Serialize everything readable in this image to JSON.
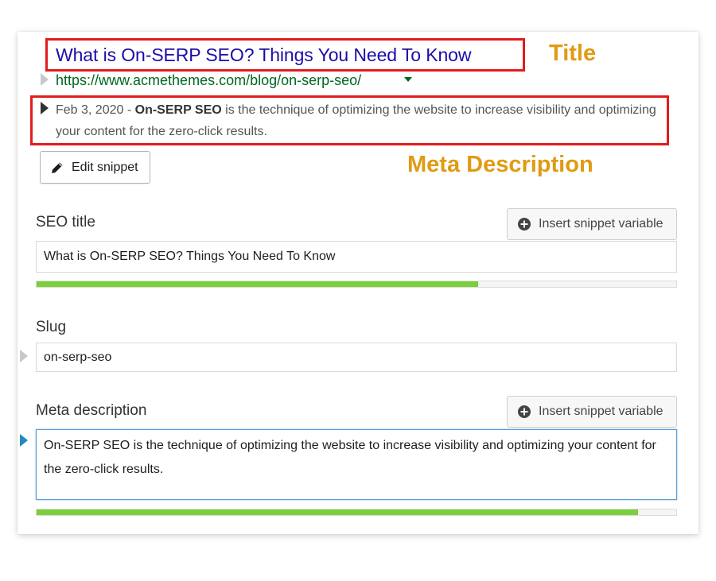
{
  "preview": {
    "title": "What is On-SERP SEO? Things You Need To Know",
    "url": "https://www.acmethemes.com/blog/on-serp-seo/",
    "date": "Feb 3, 2020",
    "separator": " - ",
    "keyword": "On-SERP SEO",
    "desc_rest": " is the technique of optimizing the website to increase visibility and optimizing your content for the zero-click results."
  },
  "annotations": {
    "title_label": "Title",
    "meta_label": "Meta Description",
    "color": "#e09b13",
    "box_color": "#e21c1c"
  },
  "buttons": {
    "edit_snippet": "Edit snippet",
    "insert_snippet_variable": "Insert snippet variable"
  },
  "fields": {
    "seo_title": {
      "label": "SEO title",
      "value": "What is On-SERP SEO? Things You Need To Know",
      "progress": 0.69
    },
    "slug": {
      "label": "Slug",
      "value": "on-serp-seo"
    },
    "meta_description": {
      "label": "Meta description",
      "value": "On-SERP SEO is the technique of optimizing the website to increase visibility and optimizing your content for the zero-click results.",
      "progress": 0.94
    }
  },
  "colors": {
    "title_link": "#1a0dab",
    "url": "#006621",
    "progress_good": "#7ad03a",
    "focus_border": "#5b9dd9"
  },
  "icons": {
    "edit": "pencil-icon",
    "insert": "plus-circle-icon"
  }
}
